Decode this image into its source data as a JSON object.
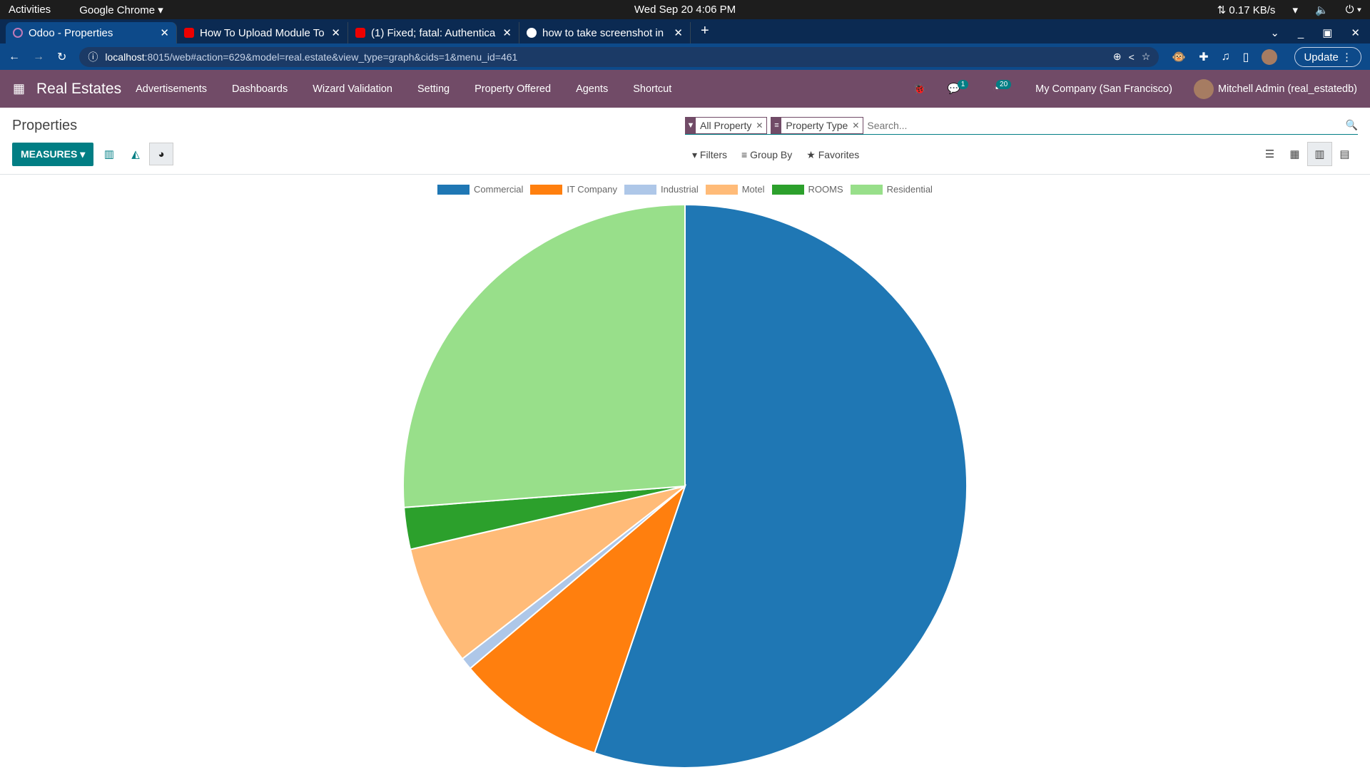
{
  "system": {
    "activities": "Activities",
    "app": "Google Chrome ▾",
    "clock": "Wed Sep 20  4:06 PM",
    "net": "⇅ 0.17 KB/s"
  },
  "browser": {
    "tabs": [
      {
        "title": "Odoo - Properties",
        "icon": "odoo"
      },
      {
        "title": "How To Upload Module To",
        "icon": "youtube"
      },
      {
        "title": "(1) Fixed; fatal: Authentica",
        "icon": "youtube"
      },
      {
        "title": "how to take screenshot in",
        "icon": "google"
      }
    ],
    "url_host": "localhost",
    "url_rest": ":8015/web#action=629&model=real.estate&view_type=graph&cids=1&menu_id=461",
    "update": "Update"
  },
  "nav": {
    "brand": "Real Estates",
    "menu": [
      "Advertisements",
      "Dashboards",
      "Wizard Validation",
      "Setting",
      "Property Offered",
      "Agents",
      "Shortcut"
    ],
    "messages_badge": "1",
    "activities_badge": "20",
    "company": "My Company (San Francisco)",
    "user": "Mitchell Admin (real_estatedb)"
  },
  "control": {
    "title": "Properties",
    "measures": "MEASURES ▾",
    "facets": [
      {
        "icon": "filter",
        "label": "All Property"
      },
      {
        "icon": "groupby",
        "label": "Property Type"
      }
    ],
    "search_placeholder": "Search...",
    "filters": "Filters",
    "group_by": "Group By",
    "favorites": "Favorites"
  },
  "chart_data": {
    "type": "pie",
    "legend_position": "top",
    "categories": [
      "Commercial",
      "IT Company",
      "Industrial",
      "Motel",
      "ROOMS",
      "Residential"
    ],
    "values": [
      55.2,
      8.6,
      0.7,
      6.9,
      2.4,
      26.2
    ],
    "colors": [
      "#1f77b4",
      "#ff7f0e",
      "#aec7e8",
      "#ffbb78",
      "#2ca02c",
      "#98df8a"
    ]
  }
}
